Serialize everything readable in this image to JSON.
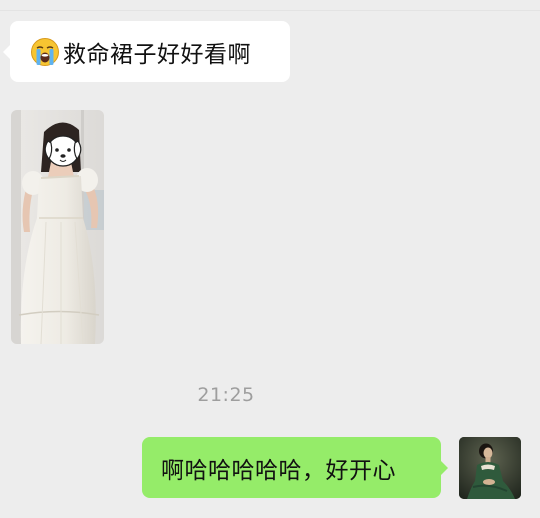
{
  "incoming": {
    "emoji": "loudly-crying-face",
    "text": "救命裙子好好看啊"
  },
  "photo": {
    "subject": "woman-in-white-dress",
    "face_sticker": "cartoon-dog-face"
  },
  "timestamp": "21:25",
  "outgoing": {
    "text": "啊哈哈哈哈哈，好开心",
    "avatar": "painted-portrait-woman-in-green"
  },
  "colors": {
    "background": "#ededed",
    "incoming_bubble": "#ffffff",
    "outgoing_bubble": "#95ec69",
    "timestamp": "#9e9e9e"
  }
}
